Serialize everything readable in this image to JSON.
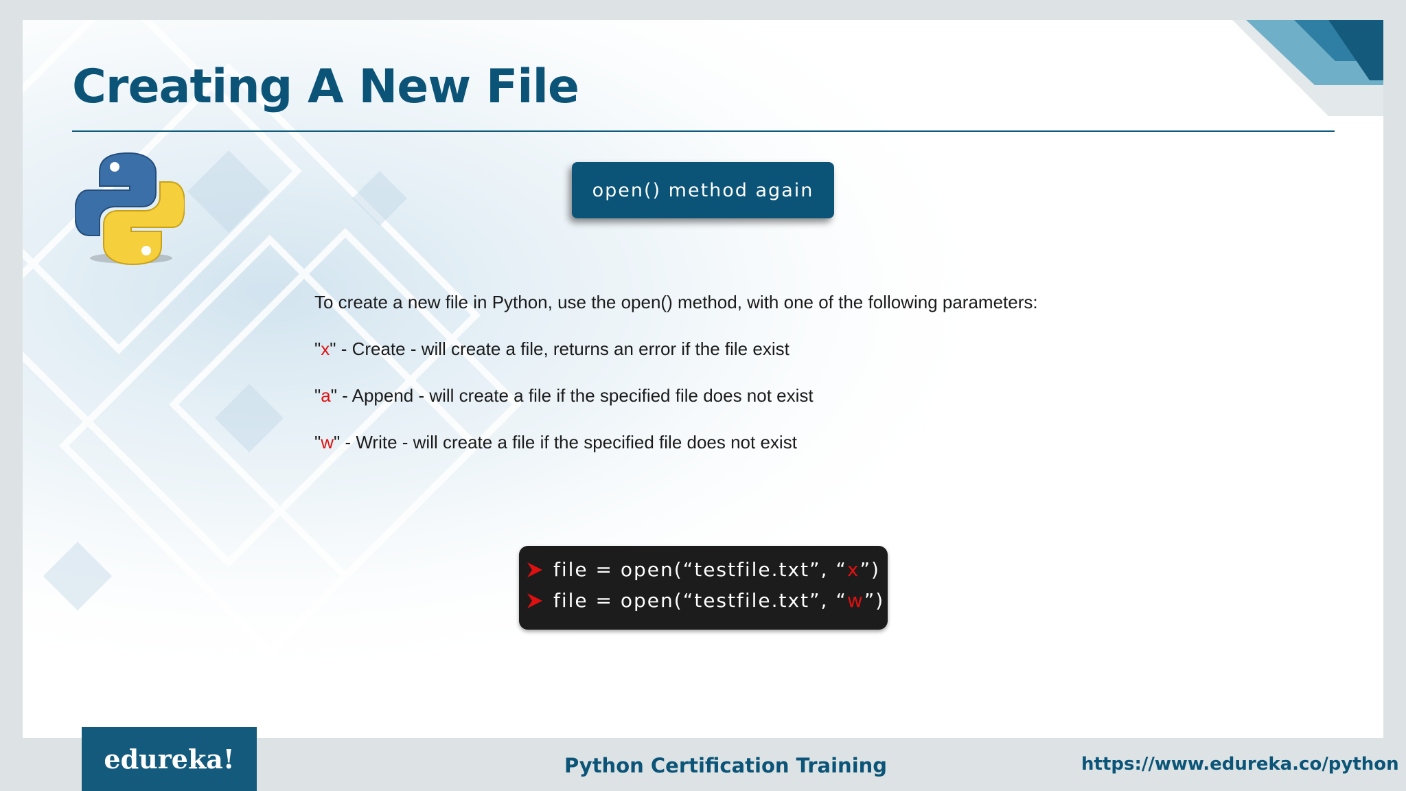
{
  "slide": {
    "title": "Creating A New File",
    "badge": "open() method again",
    "intro": "To create a new file in Python, use the open() method, with one of the following parameters:",
    "params": [
      {
        "quote_open": "\"",
        "letter": "x",
        "quote_close": "\"",
        "description": " - Create - will create a file, returns an error if the file exist"
      },
      {
        "quote_open": "\"",
        "letter": "a",
        "quote_close": "\"",
        "description": " - Append - will create a file if the specified file does not exist"
      },
      {
        "quote_open": "\"",
        "letter": "w",
        "quote_close": "\"",
        "description": " - Write - will create a file if the specified file does not exist"
      }
    ],
    "code": [
      {
        "prefix": "file = open(“testfile.txt”, “",
        "mode": "x",
        "suffix": "”)"
      },
      {
        "prefix": "file = open(“testfile.txt”, “",
        "mode": "w",
        "suffix": "”)"
      }
    ]
  },
  "footer": {
    "logo": "edureka!",
    "course": "Python Certification Training",
    "url": "https://www.edureka.co/python"
  },
  "colors": {
    "brand_blue": "#0b5478",
    "highlight_red": "#e01010",
    "code_bg": "#1c1c1c"
  },
  "icons": {
    "logo": "python-logo-icon",
    "bullet": "arrow-bullet-icon"
  }
}
